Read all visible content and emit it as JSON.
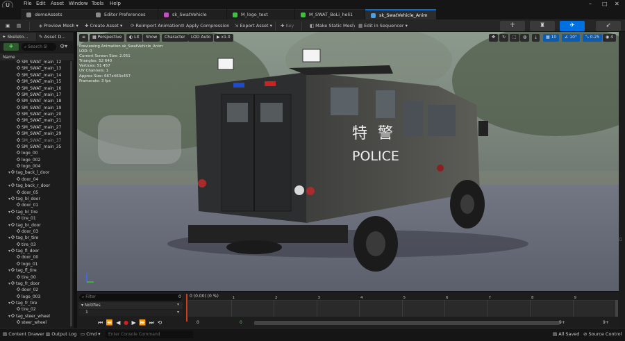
{
  "menubar": {
    "logo": "U",
    "items": [
      "File",
      "Edit",
      "Asset",
      "Window",
      "Tools",
      "Help"
    ]
  },
  "tabs": [
    {
      "label": "demoAssets",
      "color": "#8a8a8a"
    },
    {
      "label": "Editor Preferences",
      "color": "#8a8a8a"
    },
    {
      "label": "sk_SwatVehicle",
      "color": "#c050c0"
    },
    {
      "label": "M_logo_text",
      "color": "#40c040"
    },
    {
      "label": "M_SWAT_BoLi_heli1",
      "color": "#40c040"
    },
    {
      "label": "sk_SwatVehicle_Anim",
      "color": "#50a0e0"
    }
  ],
  "toolbar": {
    "preview_mesh": "Preview Mesh",
    "create_asset": "Create Asset",
    "reimport_animation": "Reimport Animation",
    "apply_compression": "Apply Compression",
    "export_asset": "Export Asset",
    "key": "Key",
    "make_static_mesh": "Make Static Mesh",
    "edit_in_sequencer": "Edit in Sequencer"
  },
  "left_panel": {
    "tabs": [
      "Skeleto...",
      "Asset D..."
    ],
    "search_placeholder": "Search Sl",
    "column_header": "Name",
    "tree": [
      {
        "label": "SM_SWAT_main_12",
        "indent": 2,
        "type": "bone"
      },
      {
        "label": "SM_SWAT_main_13",
        "indent": 2,
        "type": "bone"
      },
      {
        "label": "SM_SWAT_main_14",
        "indent": 2,
        "type": "bone"
      },
      {
        "label": "SM_SWAT_main_15",
        "indent": 2,
        "type": "bone"
      },
      {
        "label": "SM_SWAT_main_16",
        "indent": 2,
        "type": "bone"
      },
      {
        "label": "SM_SWAT_main_17",
        "indent": 2,
        "type": "bone"
      },
      {
        "label": "SM_SWAT_main_18",
        "indent": 2,
        "type": "bone"
      },
      {
        "label": "SM_SWAT_main_19",
        "indent": 2,
        "type": "bone"
      },
      {
        "label": "SM_SWAT_main_20",
        "indent": 2,
        "type": "bone"
      },
      {
        "label": "SM_SWAT_main_21",
        "indent": 2,
        "type": "bone"
      },
      {
        "label": "SM_SWAT_main_27",
        "indent": 2,
        "type": "bone"
      },
      {
        "label": "SM_SWAT_main_29",
        "indent": 2,
        "type": "bone"
      },
      {
        "label": "SM_SWAT_main_37",
        "indent": 2,
        "type": "bone",
        "dim": true
      },
      {
        "label": "SM_SWAT_main_35",
        "indent": 2,
        "type": "bone"
      },
      {
        "label": "logo_00",
        "indent": 2,
        "type": "bone"
      },
      {
        "label": "logo_002",
        "indent": 2,
        "type": "bone"
      },
      {
        "label": "logo_004",
        "indent": 2,
        "type": "bone"
      },
      {
        "label": "tag_back_l_door",
        "indent": 1,
        "type": "folder"
      },
      {
        "label": "door_04",
        "indent": 2,
        "type": "bone"
      },
      {
        "label": "tag_back_r_door",
        "indent": 1,
        "type": "folder"
      },
      {
        "label": "door_05",
        "indent": 2,
        "type": "bone"
      },
      {
        "label": "tag_bl_door",
        "indent": 1,
        "type": "folder"
      },
      {
        "label": "door_01",
        "indent": 2,
        "type": "bone"
      },
      {
        "label": "tag_bl_tire",
        "indent": 1,
        "type": "folder"
      },
      {
        "label": "tire_01",
        "indent": 2,
        "type": "bone"
      },
      {
        "label": "tag_br_door",
        "indent": 1,
        "type": "folder"
      },
      {
        "label": "door_03",
        "indent": 2,
        "type": "bone"
      },
      {
        "label": "tag_br_tire",
        "indent": 1,
        "type": "folder"
      },
      {
        "label": "tire_03",
        "indent": 2,
        "type": "bone"
      },
      {
        "label": "tag_fl_door",
        "indent": 1,
        "type": "folder"
      },
      {
        "label": "door_00",
        "indent": 2,
        "type": "bone"
      },
      {
        "label": "logo_01",
        "indent": 2,
        "type": "bone"
      },
      {
        "label": "tag_fl_tire",
        "indent": 1,
        "type": "folder"
      },
      {
        "label": "tire_00",
        "indent": 2,
        "type": "bone"
      },
      {
        "label": "tag_fr_door",
        "indent": 1,
        "type": "folder"
      },
      {
        "label": "door_02",
        "indent": 2,
        "type": "bone"
      },
      {
        "label": "logo_003",
        "indent": 2,
        "type": "bone"
      },
      {
        "label": "tag_fr_tire",
        "indent": 1,
        "type": "folder"
      },
      {
        "label": "tire_02",
        "indent": 2,
        "type": "bone"
      },
      {
        "label": "tag_steer_wheel",
        "indent": 1,
        "type": "folder"
      },
      {
        "label": "steer_wheel",
        "indent": 2,
        "type": "bone"
      }
    ]
  },
  "viewport": {
    "perspective": "Perspective",
    "lit": "Lit",
    "show": "Show",
    "character": "Character",
    "lod": "LOD Auto",
    "speed": "x1.0",
    "grid_snap": "10",
    "angle_snap": "10°",
    "scale_snap": "0.25",
    "camera_speed": "4",
    "stats": [
      "Previewing Animation sk_SwatVehicle_Anim",
      "LOD: 0",
      "Current Screen Size: 2.051",
      "Triangles: 52 640",
      "Vertices: 51 457",
      "UV Channels: 1",
      "Approx Size: 667x463x457",
      "Framerate: 3 fps"
    ],
    "vehicle_chinese": "特 警",
    "vehicle_text": "POLICE"
  },
  "timeline": {
    "filter_placeholder": "Filter",
    "frame_start": "0",
    "notifies_label": "Notifies",
    "notify_track": "1",
    "ruler_label": "0 (0.00) (0 %)",
    "ticks": [
      "1",
      "2",
      "3",
      "4",
      "5",
      "6",
      "7",
      "8",
      "9"
    ],
    "range_start": "0",
    "range_start2": "0",
    "range_end": "9+",
    "range_end2": "9+"
  },
  "statusbar": {
    "content_drawer": "Content Drawer",
    "output_log": "Output Log",
    "cmd": "Cmd",
    "console_placeholder": "Enter Console Command",
    "all_saved": "All Saved",
    "source_control": "Source Control"
  },
  "colors": {
    "accent": "#0070e0",
    "background": "#151515",
    "panel": "#1c1c1c",
    "record": "#d02020"
  }
}
